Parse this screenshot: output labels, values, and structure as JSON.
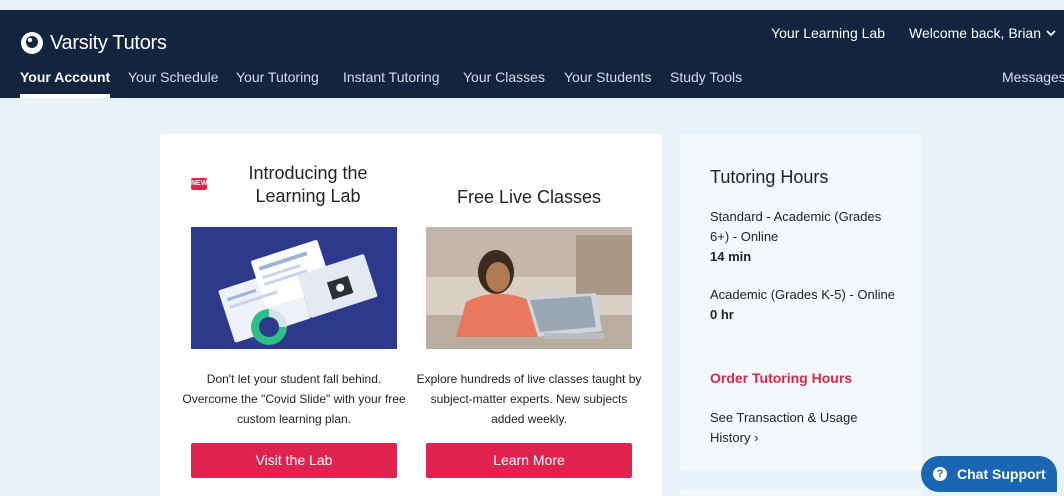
{
  "brand": {
    "name": "Varsity Tutors"
  },
  "header": {
    "learning_lab_link": "Your Learning Lab",
    "welcome": "Welcome back, Brian"
  },
  "nav": {
    "items": [
      "Your Account",
      "Your Schedule",
      "Your Tutoring",
      "Instant Tutoring",
      "Your Classes",
      "Your Students",
      "Study Tools"
    ],
    "messages": "Messages",
    "active": "Your Account"
  },
  "promo": {
    "lab": {
      "badge": "NEW",
      "title": "Introducing the Learning Lab",
      "description": "Don't let your student fall behind. Overcome the \"Covid Slide\" with your free custom learning plan.",
      "button": "Visit the Lab"
    },
    "classes": {
      "title": "Free Live Classes",
      "description": "Explore hundreds of live classes taught by subject-matter experts. New subjects added weekly.",
      "button": "Learn More"
    }
  },
  "tutoring_hours": {
    "title": "Tutoring Hours",
    "entries": [
      {
        "label": "Standard - Academic (Grades 6+) - Online",
        "amount": "14 min"
      },
      {
        "label": "Academic (Grades K-5) - Online",
        "amount": "0 hr"
      }
    ],
    "order_link": "Order Tutoring Hours",
    "history_link": "See Transaction & Usage History",
    "history_arrow": "›"
  },
  "chat": {
    "label": "Chat Support",
    "icon": "?"
  },
  "colors": {
    "navy": "#13243f",
    "accent": "#e0234e",
    "chat": "#1a66b3",
    "background": "#e9f2f7"
  }
}
